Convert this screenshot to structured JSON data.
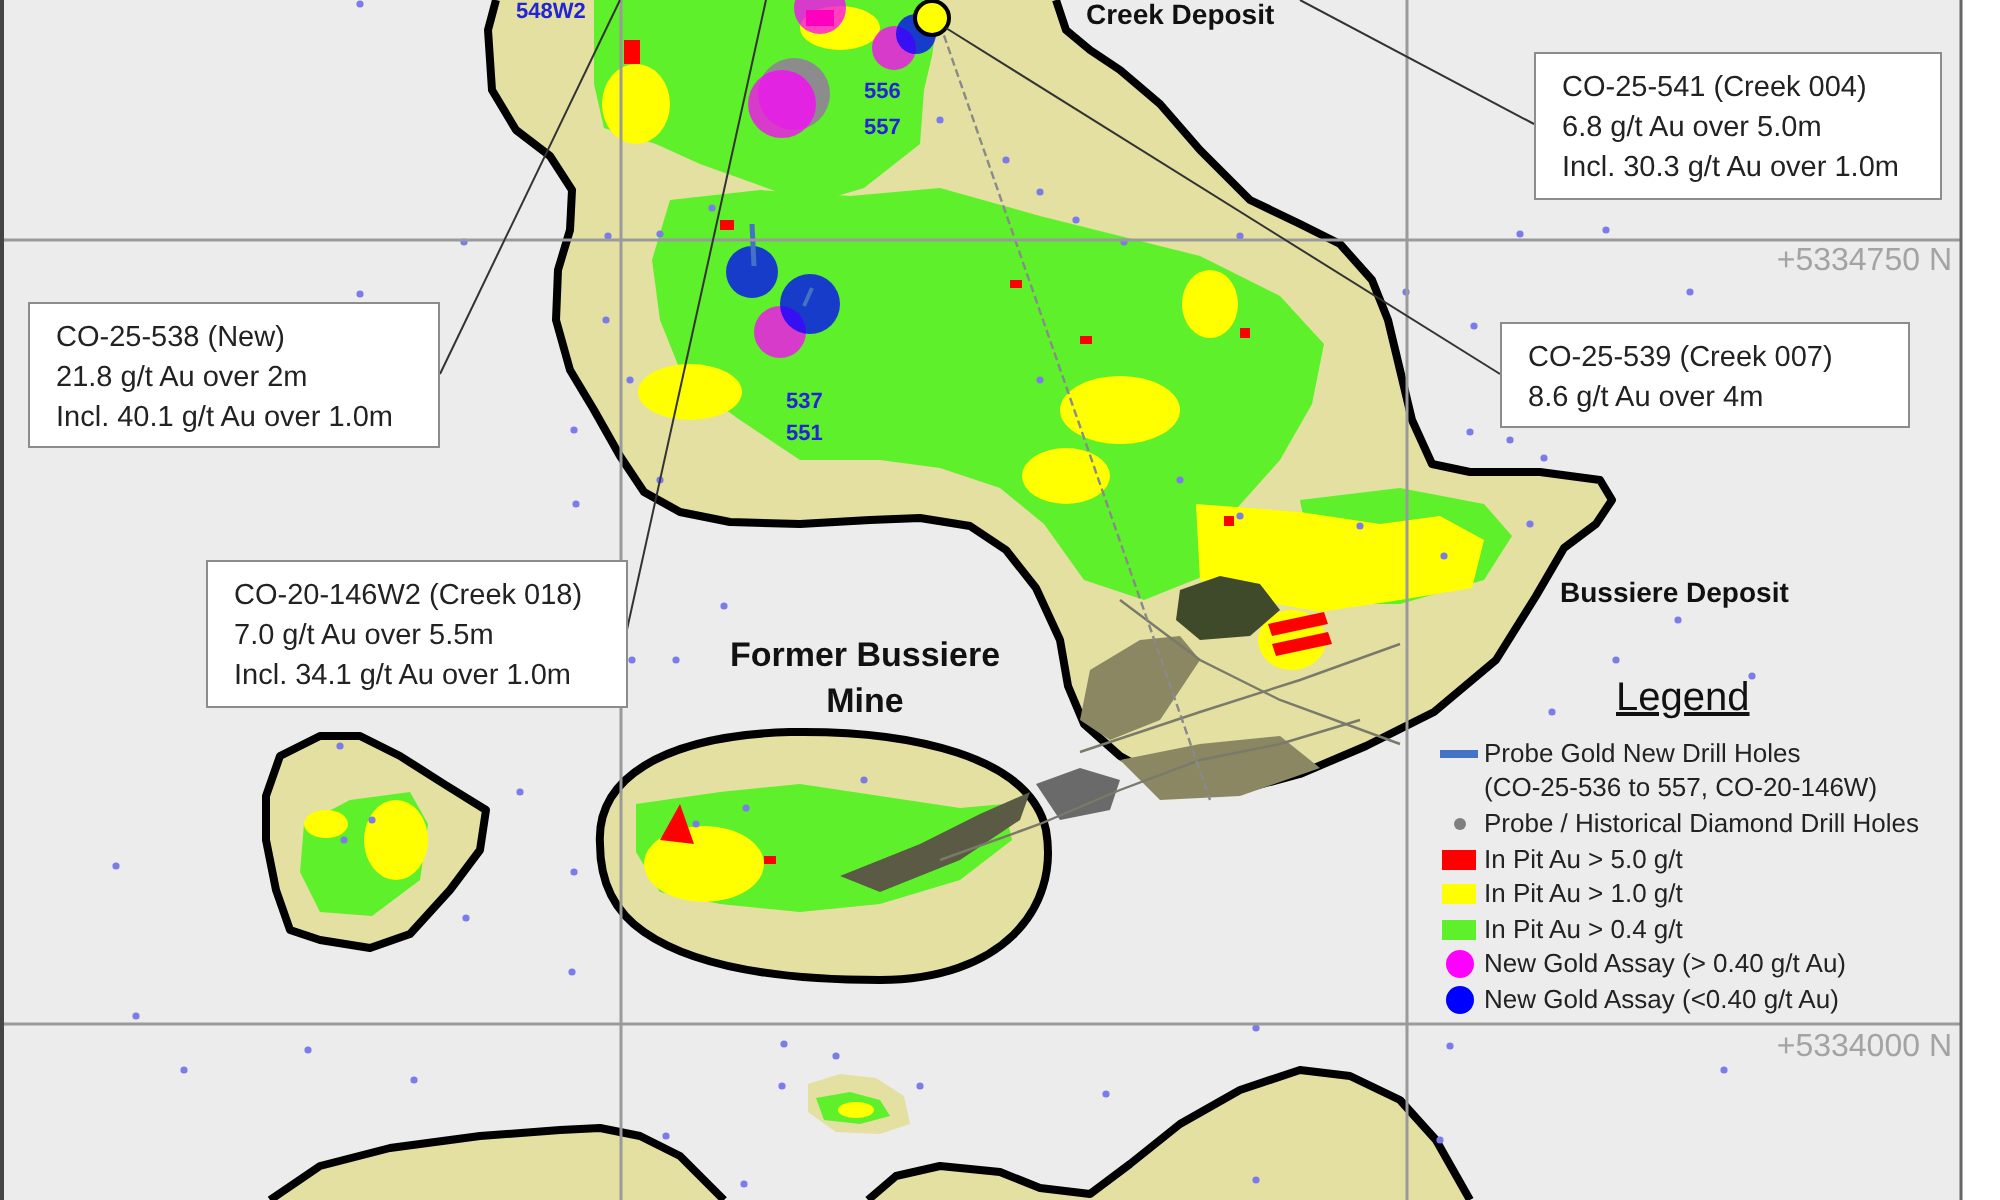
{
  "map": {
    "deposit_labels": [
      "Creek Deposit",
      "Bussiere Deposit",
      "Former Bussiere Mine"
    ],
    "hole_labels": [
      "548W2",
      "556",
      "557",
      "537",
      "551"
    ],
    "grid_labels": [
      "+5334750 N",
      "+5334000 N"
    ],
    "callouts": [
      {
        "lines": [
          "CO-25-541 (Creek 004)",
          "6.8 g/t Au over 5.0m",
          "Incl. 30.3 g/t Au over 1.0m"
        ]
      },
      {
        "lines": [
          "CO-25-538 (New)",
          "21.8 g/t Au over 2m",
          "Incl. 40.1 g/t Au over 1.0m"
        ]
      },
      {
        "lines": [
          "CO-25-539 (Creek 007)",
          "8.6 g/t Au over 4m"
        ]
      },
      {
        "lines": [
          "CO-20-146W2 (Creek 018)",
          "7.0 g/t Au over 5.5m",
          "Incl. 34.1 g/t Au over 1.0m"
        ]
      }
    ]
  },
  "legend": {
    "title": "Legend",
    "items": [
      {
        "kind": "line",
        "color": "#4472c4",
        "label": "Probe Gold New Drill Holes",
        "note": "(CO-25-536 to 557, CO-20-146W)"
      },
      {
        "kind": "dot",
        "color": "#7f7f7f",
        "label": "Probe / Historical Diamond Drill Holes"
      },
      {
        "kind": "rect",
        "color": "#ff0000",
        "label": "In Pit Au > 5.0 g/t"
      },
      {
        "kind": "rect",
        "color": "#ffff00",
        "label": "In Pit Au > 1.0 g/t"
      },
      {
        "kind": "rect",
        "color": "#5ef02a",
        "label": "In Pit Au > 0.4 g/t"
      },
      {
        "kind": "circle",
        "color": "#ff00ff",
        "label": "New Gold Assay (> 0.40 g/t Au)"
      },
      {
        "kind": "circle",
        "color": "#0000ff",
        "label": "New Gold Assay (<0.40 g/t Au)"
      }
    ]
  }
}
